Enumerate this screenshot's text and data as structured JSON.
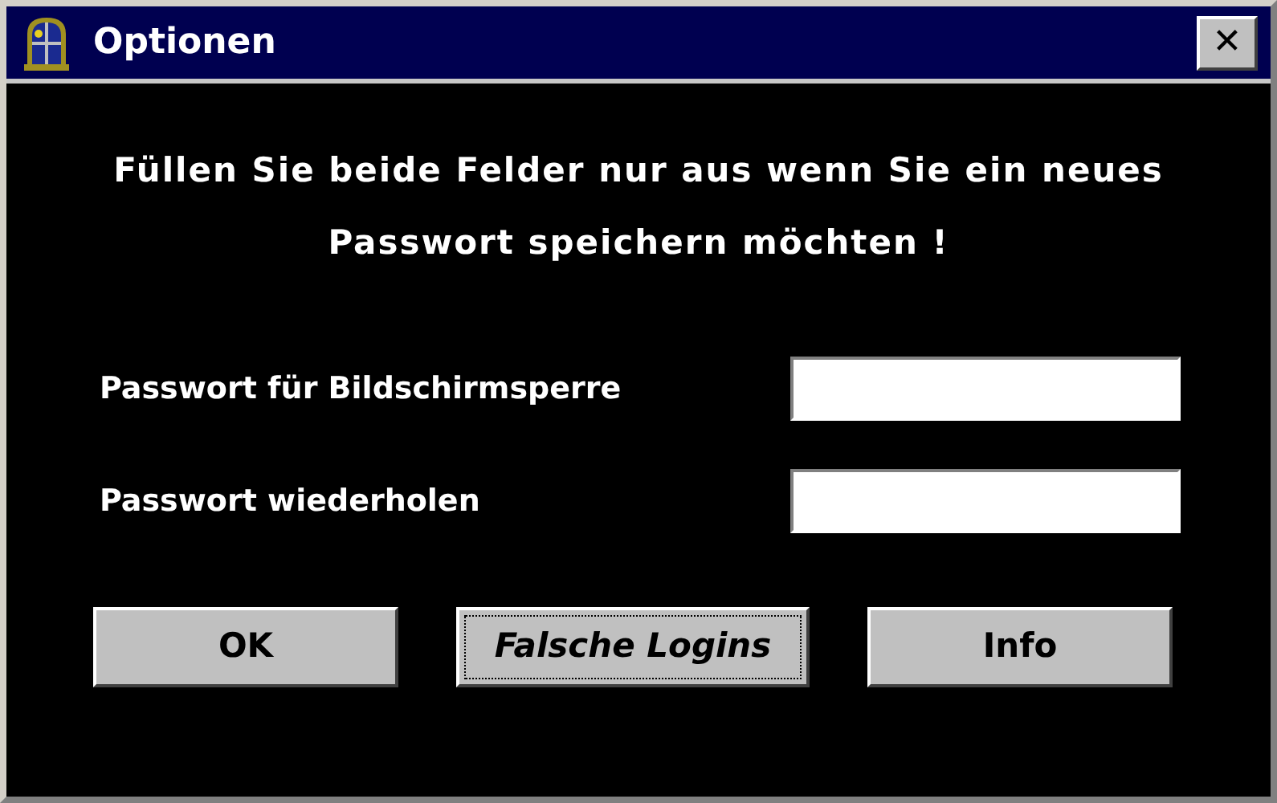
{
  "window": {
    "title": "Optionen",
    "close": "✕"
  },
  "message": "Füllen Sie beide Felder nur aus wenn Sie ein neues Passwort speichern möchten !",
  "fields": [
    {
      "label": "Passwort für Bildschirmsperre"
    },
    {
      "label": "Passwort wiederholen"
    }
  ],
  "buttons": [
    {
      "label": "OK",
      "focused": false
    },
    {
      "label": "Falsche Logins",
      "focused": true
    },
    {
      "label": "Info",
      "focused": false
    }
  ]
}
